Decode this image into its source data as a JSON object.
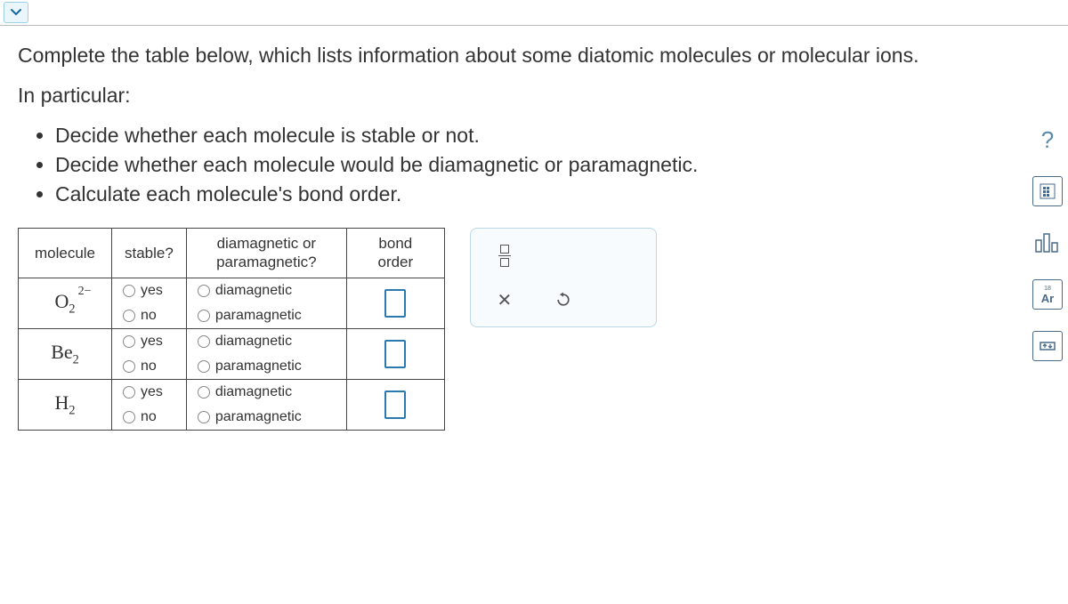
{
  "prompt": {
    "line1": "Complete the table below, which lists information about some diatomic molecules or molecular ions.",
    "line2": "In particular:",
    "bullets": [
      "Decide whether each molecule is stable or not.",
      "Decide whether each molecule would be diamagnetic or paramagnetic.",
      "Calculate each molecule's bond order."
    ]
  },
  "table": {
    "headers": {
      "molecule": "molecule",
      "stable": "stable?",
      "magnetism": "diamagnetic or paramagnetic?",
      "bond_order": "bond order"
    },
    "options": {
      "yes": "yes",
      "no": "no",
      "dia": "diamagnetic",
      "para": "paramagnetic"
    },
    "rows": [
      {
        "formula_html": "O<sub>2</sub><sup>2&minus;</sup>",
        "bond_order": ""
      },
      {
        "formula_html": "Be<sub>2</sub>",
        "bond_order": ""
      },
      {
        "formula_html": "H<sub>2</sub>",
        "bond_order": ""
      }
    ]
  },
  "sidebar": {
    "help": "?",
    "periodic": "Ar"
  }
}
